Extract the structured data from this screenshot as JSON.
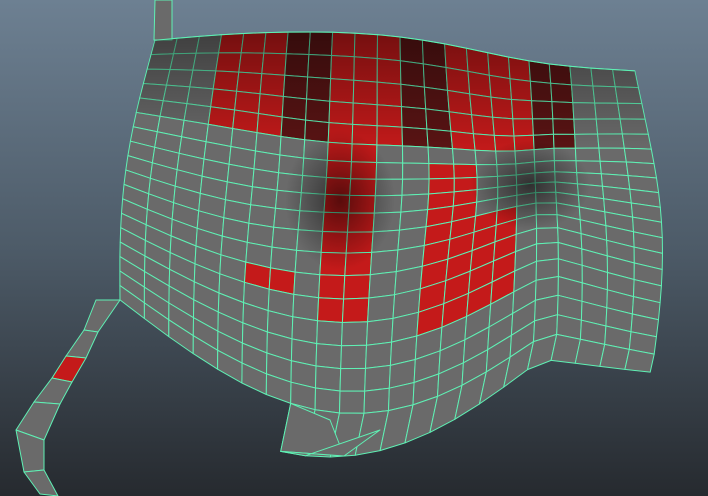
{
  "viewport": {
    "background_top": "#6d8092",
    "background_mid": "#4d5b68",
    "background_bottom": "#262a2f",
    "wireframe_color": "#5ff0b4",
    "face_gray": "#6a6a6a",
    "face_red": "#c41a1a",
    "face_dark_red": "#5a1414"
  }
}
